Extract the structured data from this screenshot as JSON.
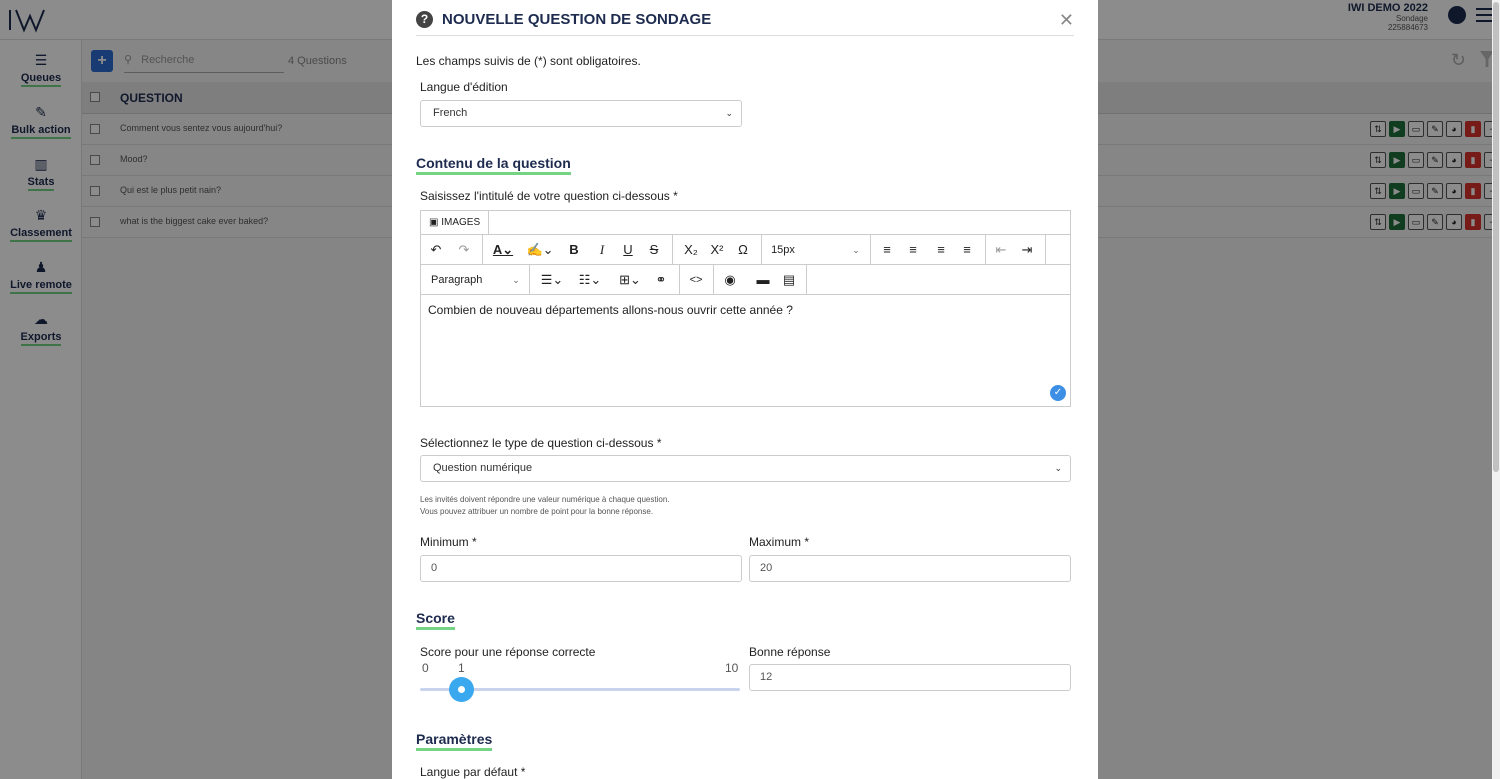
{
  "app": {
    "account_title": "IWI DEMO 2022",
    "account_sub": "Sondage",
    "account_id": "225884673"
  },
  "sidebar": {
    "items": [
      {
        "label": "Queues",
        "icon": "list-icon"
      },
      {
        "label": "Bulk action",
        "icon": "magic-wand-icon"
      },
      {
        "label": "Stats",
        "icon": "bar-chart-icon"
      },
      {
        "label": "Classement",
        "icon": "trophy-icon"
      },
      {
        "label": "Live remote",
        "icon": "joystick-icon"
      },
      {
        "label": "Exports",
        "icon": "cloud-download-icon"
      }
    ]
  },
  "toolbar": {
    "add_label": "+",
    "search_placeholder": "Recherche",
    "count": "4 Questions"
  },
  "table": {
    "header": "QUESTION",
    "rows": [
      "Comment vous sentez vous aujourd'hui?",
      "Mood?",
      "Qui est le plus petit nain?",
      "what is the biggest cake ever baked?"
    ]
  },
  "modal": {
    "title": "NOUVELLE QUESTION DE SONDAGE",
    "close": "✕",
    "required_note": "Les champs suivis de (*) sont obligatoires.",
    "lang_label": "Langue d'édition",
    "lang_value": "French",
    "section_content": "Contenu de la question",
    "question_label": "Saisissez l'intitulé de votre question ci-dessous *",
    "images_btn": "IMAGES",
    "font_size": "15px",
    "block_format": "Paragraph",
    "editor_text": "Combien de nouveau départements allons-nous ouvrir cette année ?",
    "type_label": "Sélectionnez le type de question ci-dessous *",
    "type_value": "Question numérique",
    "hint_line1": "Les invités doivent répondre une valeur numérique à chaque question.",
    "hint_line2": "Vous pouvez attribuer un nombre de point pour la bonne réponse.",
    "min_label": "Minimum *",
    "min_value": "0",
    "max_label": "Maximum *",
    "max_value": "20",
    "section_score": "Score",
    "score_label": "Score pour une réponse correcte",
    "score_min": "0",
    "score_value": "1",
    "score_max": "10",
    "good_label": "Bonne réponse",
    "good_value": "12",
    "section_params": "Paramètres",
    "default_lang_label": "Langue par défaut *"
  },
  "colors": {
    "accent": "#74d384",
    "navy": "#1d2b4f",
    "slider": "#3aa8ee"
  }
}
